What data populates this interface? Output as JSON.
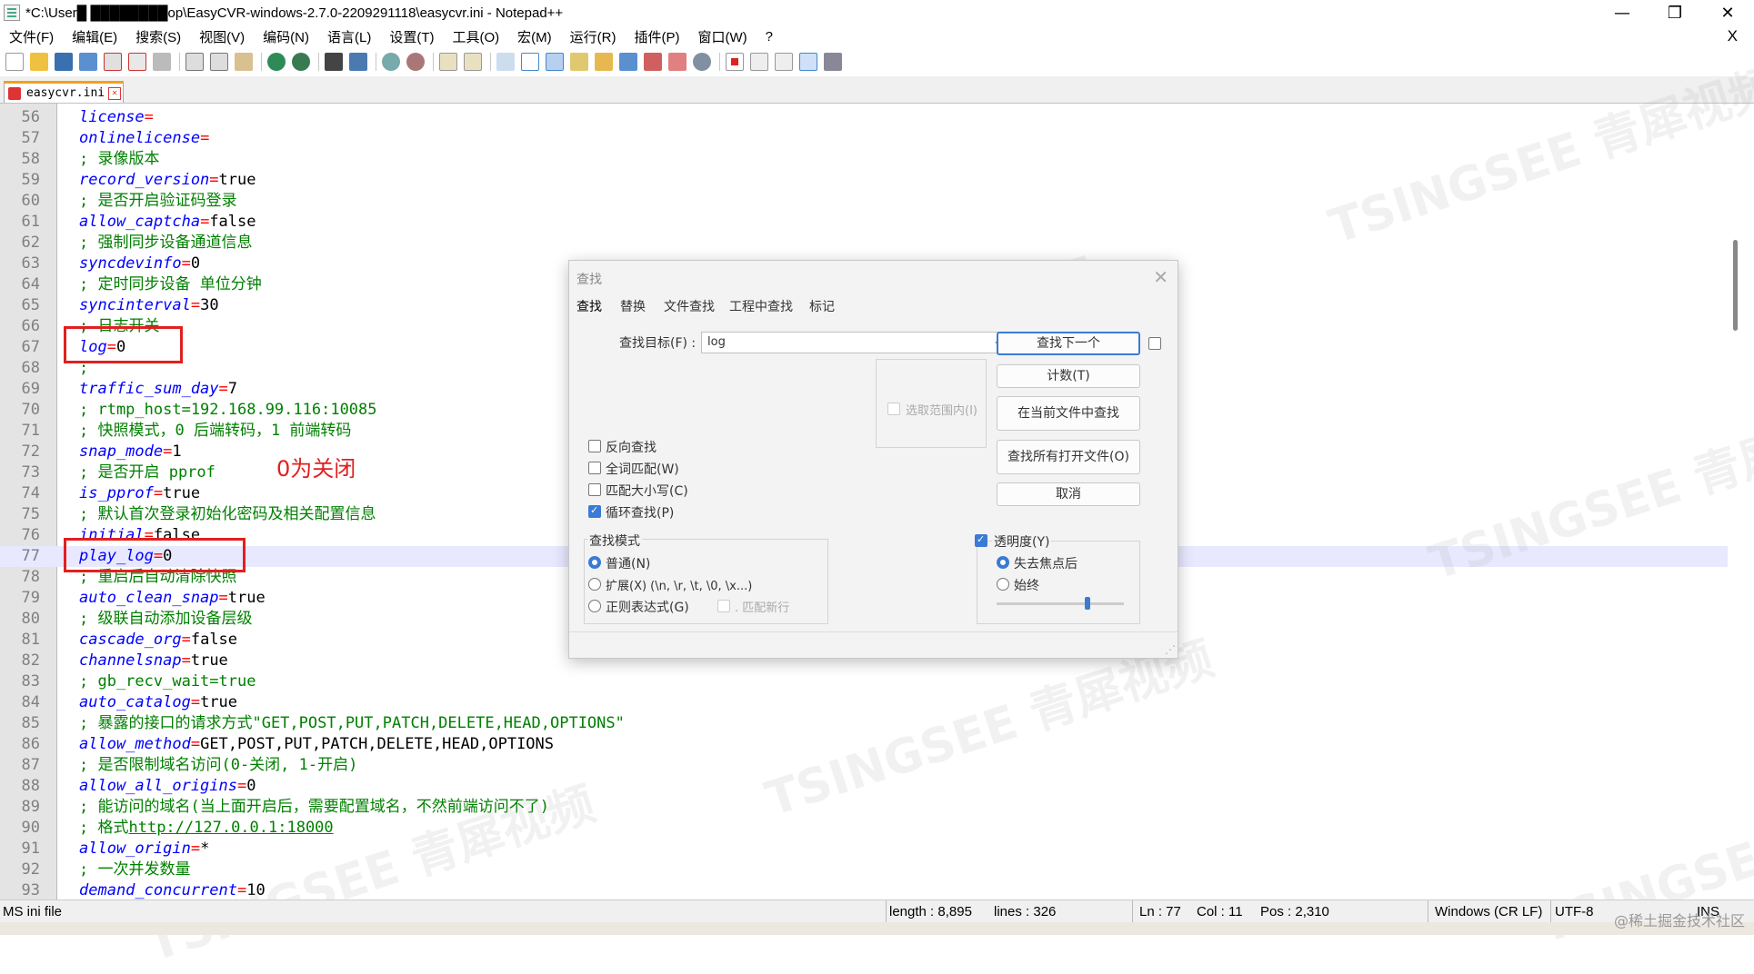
{
  "window": {
    "title": "*C:\\User█ ████████op\\EasyCVR-windows-2.7.0-2209291118\\easycvr.ini - Notepad++",
    "minimize": "—",
    "maximize": "❐",
    "close": "✕"
  },
  "menu": {
    "items": [
      "文件(F)",
      "编辑(E)",
      "搜索(S)",
      "视图(V)",
      "编码(N)",
      "语言(L)",
      "设置(T)",
      "工具(O)",
      "宏(M)",
      "运行(R)",
      "插件(P)",
      "窗口(W)",
      "?"
    ],
    "close": "X"
  },
  "tab": {
    "label": "easycvr.ini"
  },
  "lines": [
    {
      "n": "56",
      "key": "license",
      "eq": "=",
      "val": ""
    },
    {
      "n": "57",
      "key": "onlinelicense",
      "eq": "=",
      "val": ""
    },
    {
      "n": "58",
      "comment": "; 录像版本"
    },
    {
      "n": "59",
      "key": "record_version",
      "eq": "=",
      "val": "true"
    },
    {
      "n": "60",
      "comment": "; 是否开启验证码登录"
    },
    {
      "n": "61",
      "key": "allow_captcha",
      "eq": "=",
      "val": "false"
    },
    {
      "n": "62",
      "comment": "; 强制同步设备通道信息"
    },
    {
      "n": "63",
      "key": "syncdevinfo",
      "eq": "=",
      "val": "0"
    },
    {
      "n": "64",
      "comment": "; 定时同步设备 单位分钟"
    },
    {
      "n": "65",
      "key": "syncinterval",
      "eq": "=",
      "val": "30"
    },
    {
      "n": "66",
      "comment": "; 日志开关"
    },
    {
      "n": "67",
      "key": "log",
      "eq": "=",
      "val": "0"
    },
    {
      "n": "68",
      "comment": ";"
    },
    {
      "n": "69",
      "key": "traffic_sum_day",
      "eq": "=",
      "val": "7"
    },
    {
      "n": "70",
      "comment": "; rtmp_host=192.168.99.116:10085"
    },
    {
      "n": "71",
      "comment": "; 快照模式，0 后端转码，1 前端转码"
    },
    {
      "n": "72",
      "key": "snap_mode",
      "eq": "=",
      "val": "1"
    },
    {
      "n": "73",
      "comment": "; 是否开启 pprof"
    },
    {
      "n": "74",
      "key": "is_pprof",
      "eq": "=",
      "val": "true"
    },
    {
      "n": "75",
      "comment": "; 默认首次登录初始化密码及相关配置信息"
    },
    {
      "n": "76",
      "key": "initial",
      "eq": "=",
      "val": "false"
    },
    {
      "n": "77",
      "key": "play_log",
      "eq": "=",
      "val": "0",
      "current": true
    },
    {
      "n": "78",
      "comment": "; 重启后自动清除快照"
    },
    {
      "n": "79",
      "key": "auto_clean_snap",
      "eq": "=",
      "val": "true"
    },
    {
      "n": "80",
      "comment": "; 级联自动添加设备层级"
    },
    {
      "n": "81",
      "key": "cascade_org",
      "eq": "=",
      "val": "false"
    },
    {
      "n": "82",
      "key": "channelsnap",
      "eq": "=",
      "val": "true"
    },
    {
      "n": "83",
      "comment": "; gb_recv_wait=true"
    },
    {
      "n": "84",
      "key": "auto_catalog",
      "eq": "=",
      "val": "true"
    },
    {
      "n": "85",
      "comment": "; 暴露的接口的请求方式\"GET,POST,PUT,PATCH,DELETE,HEAD,OPTIONS\""
    },
    {
      "n": "86",
      "key": "allow_method",
      "eq": "=",
      "val": "GET,POST,PUT,PATCH,DELETE,HEAD,OPTIONS"
    },
    {
      "n": "87",
      "comment": "; 是否限制域名访问(0-关闭, 1-开启)"
    },
    {
      "n": "88",
      "key": "allow_all_origins",
      "eq": "=",
      "val": "0"
    },
    {
      "n": "89",
      "comment": "; 能访问的域名(当上面开启后，需要配置域名，不然前端访问不了)"
    },
    {
      "n": "90",
      "comment": "; 格式",
      "url": "http://127.0.0.1:18000"
    },
    {
      "n": "91",
      "key": "allow_origin",
      "eq": "=",
      "val": "*"
    },
    {
      "n": "92",
      "comment": "; 一次并发数量"
    },
    {
      "n": "93",
      "key": "demand_concurrent",
      "eq": "=",
      "val": "10"
    }
  ],
  "annotation": {
    "text": "0为关闭"
  },
  "dialog": {
    "title": "查找",
    "close": "✕",
    "tabs": [
      "查找",
      "替换",
      "文件查找",
      "工程中查找",
      "标记"
    ],
    "find_label": "查找目标(F) :",
    "find_value": "log",
    "buttons": {
      "find_next": "查找下一个",
      "count": "计数(T)",
      "find_in_current": "在当前文件中查找",
      "find_all_open": "查找所有打开文件(O)",
      "cancel": "取消"
    },
    "in_selection": "选取范围内(I)",
    "options": {
      "reverse": "反向查找",
      "whole_word": "全词匹配(W)",
      "match_case": "匹配大小写(C)",
      "wrap": "循环查找(P)"
    },
    "search_mode": {
      "title": "查找模式",
      "normal": "普通(N)",
      "extended": "扩展(X) (\\n, \\r, \\t, \\0, \\x...)",
      "regex": "正则表达式(G)",
      "dot_newline": ". 匹配新行"
    },
    "transparency": {
      "label": "透明度(Y)",
      "on_lose_focus": "失去焦点后",
      "always": "始终",
      "level": 0.6
    }
  },
  "status": {
    "filetype": "MS ini file",
    "length": "length : 8,895",
    "lines": "lines : 326",
    "ln": "Ln : 77",
    "col": "Col : 11",
    "pos": "Pos : 2,310",
    "eol": "Windows (CR LF)",
    "encoding": "UTF-8",
    "mode": "INS"
  },
  "watermark": {
    "text": "TSINGSEE 青犀视频",
    "credit": "@稀土掘金技术社区"
  }
}
